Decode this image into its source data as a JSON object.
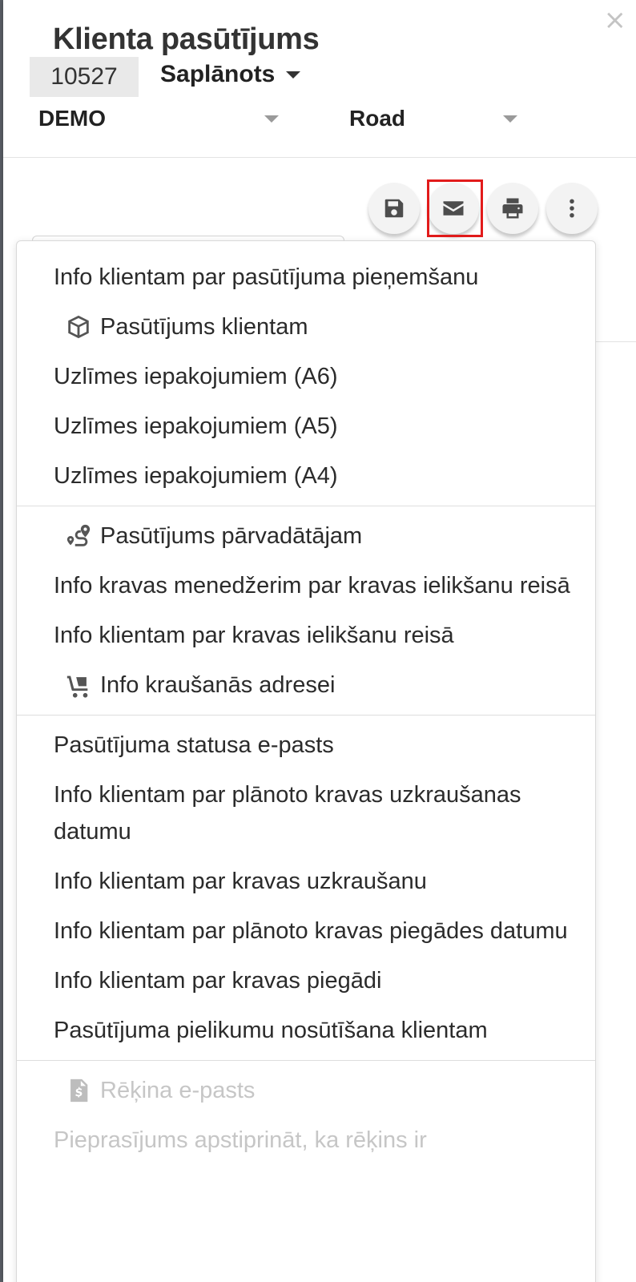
{
  "header": {
    "title": "Klienta pasūtījums",
    "order_number": "10527",
    "status": "Saplānots",
    "company": "DEMO",
    "transport": "Road",
    "close_label": "×"
  },
  "toolbar": {
    "save_icon": "save-icon",
    "email_icon": "envelope-icon",
    "print_icon": "print-icon",
    "more_icon": "more-vertical-icon",
    "highlight_color": "#e21b1b"
  },
  "email_menu": {
    "groups": [
      {
        "items": [
          {
            "label": "Info klientam par pasūtījuma pieņemšanu",
            "icon": null,
            "enabled": true
          },
          {
            "label": "Pasūtījums klientam",
            "icon": "box-icon",
            "enabled": true
          },
          {
            "label": "Uzlīmes iepakojumiem (A6)",
            "icon": null,
            "enabled": true
          },
          {
            "label": "Uzlīmes iepakojumiem (A5)",
            "icon": null,
            "enabled": true
          },
          {
            "label": "Uzlīmes iepakojumiem (A4)",
            "icon": null,
            "enabled": true
          }
        ]
      },
      {
        "items": [
          {
            "label": "Pasūtījums pārvadātājam",
            "icon": "route-icon",
            "enabled": true
          },
          {
            "label": "Info kravas menedžerim par kravas ielikšanu reisā",
            "icon": null,
            "enabled": true
          },
          {
            "label": "Info klientam par kravas ielikšanu reisā",
            "icon": null,
            "enabled": true
          },
          {
            "label": "Info kraušanās adresei",
            "icon": "dolly-icon",
            "enabled": true
          }
        ]
      },
      {
        "items": [
          {
            "label": "Pasūtījuma statusa e-pasts",
            "icon": null,
            "enabled": true
          },
          {
            "label": "Info klientam par plānoto kravas uzkraušanas datumu",
            "icon": null,
            "enabled": true
          },
          {
            "label": "Info klientam par kravas uzkraušanu",
            "icon": null,
            "enabled": true
          },
          {
            "label": "Info klientam par plānoto kravas piegādes datumu",
            "icon": null,
            "enabled": true
          },
          {
            "label": "Info klientam par kravas piegādi",
            "icon": null,
            "enabled": true
          },
          {
            "label": "Pasūtījuma pielikumu nosūtīšana klientam",
            "icon": null,
            "enabled": true
          }
        ]
      },
      {
        "items": [
          {
            "label": "Rēķina e-pasts",
            "icon": "invoice-icon",
            "enabled": false
          },
          {
            "label": "Pieprasījums apstiprināt, ka rēķins ir",
            "icon": null,
            "enabled": false
          }
        ]
      }
    ]
  }
}
